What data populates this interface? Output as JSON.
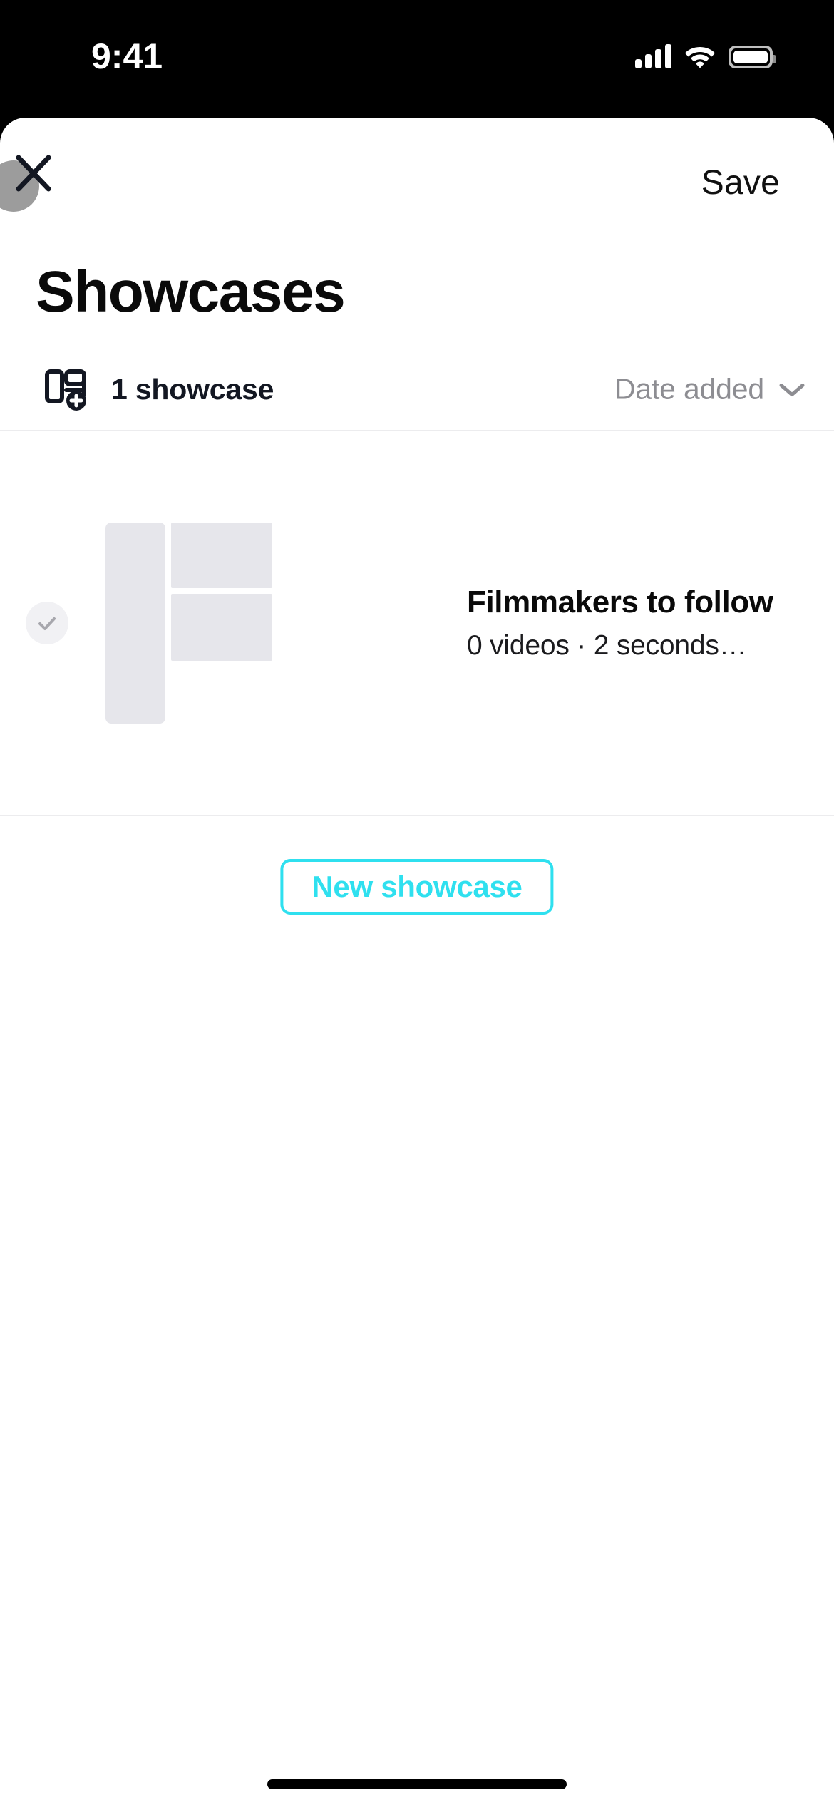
{
  "status_bar": {
    "time": "9:41",
    "icons": [
      "cellular-signal-icon",
      "wifi-icon",
      "battery-icon"
    ]
  },
  "top_bar": {
    "close_icon": "close-icon",
    "save_label": "Save"
  },
  "header": {
    "title": "Showcases"
  },
  "meta": {
    "icon": "new-showcase-layout-icon",
    "count_label": "1 showcase",
    "sort_label": "Date added",
    "sort_chevron": "chevron-down-icon"
  },
  "showcases": [
    {
      "selected": false,
      "check_icon": "check-icon",
      "title": "Filmmakers to follow",
      "subtitle": "0 videos · 2 seconds…"
    }
  ],
  "actions": {
    "new_showcase_label": "New showcase"
  },
  "colors": {
    "accent": "#2FE0EF",
    "thumb_placeholder": "#E6E6EB",
    "divider": "#ECECEE",
    "muted_text": "#8D8D92",
    "close_circle": "#9C9C9C"
  }
}
